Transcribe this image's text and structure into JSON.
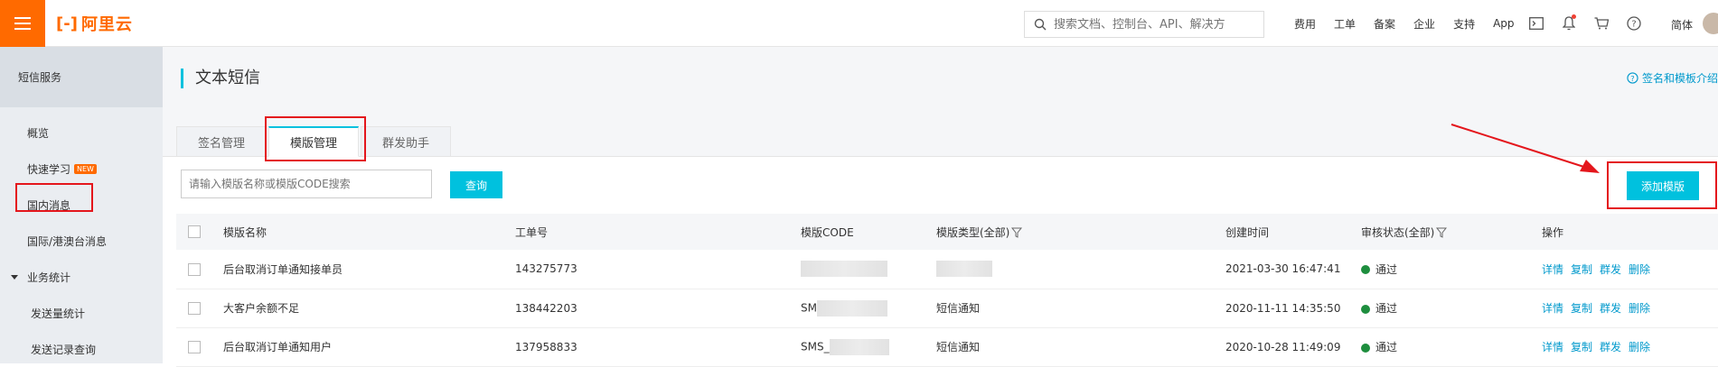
{
  "brand": {
    "logo_text": "阿里云",
    "accent": "#ff6a00"
  },
  "header": {
    "search_placeholder": "搜索文档、控制台、API、解决方",
    "links": [
      "费用",
      "工单",
      "备案",
      "企业",
      "支持",
      "App"
    ],
    "lang": "简体",
    "icons": [
      "terminal-icon",
      "bell-icon",
      "cart-icon",
      "help-icon"
    ]
  },
  "sidebar": {
    "heading": "短信服务",
    "items": [
      {
        "label": "概览"
      },
      {
        "label": "快速学习",
        "badge": "NEW"
      },
      {
        "label": "国内消息"
      },
      {
        "label": "国际/港澳台消息"
      },
      {
        "label": "业务统计"
      },
      {
        "label": "发送量统计"
      },
      {
        "label": "发送记录查询"
      }
    ]
  },
  "page": {
    "title": "文本短信",
    "help_link": "签名和模板介绍",
    "tabs": [
      {
        "label": "签名管理"
      },
      {
        "label": "模版管理"
      },
      {
        "label": "群发助手"
      }
    ],
    "filter_placeholder": "请输入模版名称或模版CODE搜索",
    "query_label": "查询",
    "add_label": "添加模版"
  },
  "table": {
    "headers": [
      "模版名称",
      "工单号",
      "模版CODE",
      "模版类型(全部)",
      "创建时间",
      "审核状态(全部)",
      "操作"
    ],
    "rows": [
      {
        "name": "后台取消订单通知接单员",
        "ticket": "143275773",
        "code": "",
        "type": "",
        "created": "2021-03-30 16:47:41",
        "status": "通过"
      },
      {
        "name": "大客户余额不足",
        "ticket": "138442203",
        "code": "SM",
        "type": "短信通知",
        "created": "2020-11-11 14:35:50",
        "status": "通过"
      },
      {
        "name": "后台取消订单通知用户",
        "ticket": "137958833",
        "code": "SMS_",
        "type": "短信通知",
        "created": "2020-10-28 11:49:09",
        "status": "通过"
      }
    ],
    "ops": [
      "详情",
      "复制",
      "群发",
      "删除"
    ]
  },
  "colors": {
    "primary": "#00c1de",
    "status_ok": "#1e8e3e",
    "highlight": "#e4161c"
  }
}
